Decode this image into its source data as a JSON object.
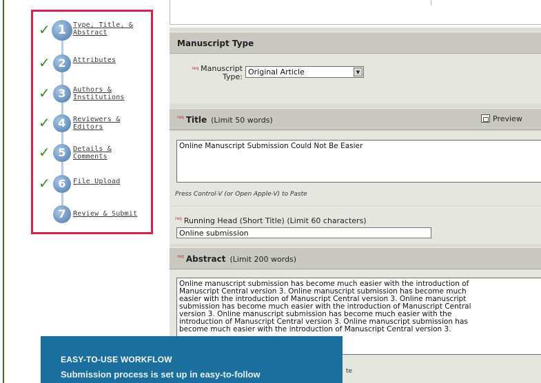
{
  "steps": [
    {
      "number": "1",
      "label_line1": "Type, Title, &",
      "label_line2": "Abstract",
      "check": "✓"
    },
    {
      "number": "2",
      "label_line1": "Attributes",
      "label_line2": "",
      "check": "✓"
    },
    {
      "number": "3",
      "label_line1": "Authors &",
      "label_line2": "Institutions",
      "check": "✓"
    },
    {
      "number": "4",
      "label_line1": "Reviewers &",
      "label_line2": "Editors",
      "check": "✓"
    },
    {
      "number": "5",
      "label_line1": "Details &",
      "label_line2": "Comments",
      "check": "✓"
    },
    {
      "number": "6",
      "label_line1": "File Upload",
      "label_line2": "",
      "check": "✓"
    },
    {
      "number": "7",
      "label_line1": "Review & Submit",
      "label_line2": "",
      "check": ""
    }
  ],
  "manuscript_type": {
    "heading": "Manuscript Type",
    "req": "req",
    "field_label_line1": "Manuscript",
    "field_label_line2": "Type:",
    "selected_value": "Original Article"
  },
  "title_section": {
    "req": "req",
    "heading": "Title",
    "limit": "(Limit 50 words)",
    "preview_label": "Preview",
    "value": "Online Manuscript Submission Could Not Be Easier",
    "paste_hint": "Press Control-V (or Open Apple-V) to Paste"
  },
  "running_head": {
    "req": "req",
    "label": "Running Head (Short Title)  (Limit 60 characters)",
    "value": "Online submission"
  },
  "abstract_section": {
    "req": "req",
    "heading": "Abstract",
    "limit": "(Limit 200 words)",
    "lines": [
      "Online manuscript submission has become much easier with the introduction of",
      "Manuscript Central version 3. Online manuscript submission has become much",
      "easier with the introduction of Manuscript Central version 3. Online manuscript",
      "submission has become much easier with the introduction of Manuscript Central",
      "version 3. Online manuscript submission has become much easier with the",
      "introduction of Manuscript Central version 3. Online manuscript submission has",
      "become much easier with the introduction of Manuscript Central version 3."
    ],
    "partial_below": "te"
  },
  "caption": {
    "title": "EASY-TO-USE WORKFLOW",
    "text": "Submission process is set up in easy-to-follow"
  },
  "colors": {
    "highlight_border": "#d2234c",
    "check": "#3f8a28",
    "caption_bg": "#1a6f9f",
    "frame": "#3f6e2a"
  }
}
